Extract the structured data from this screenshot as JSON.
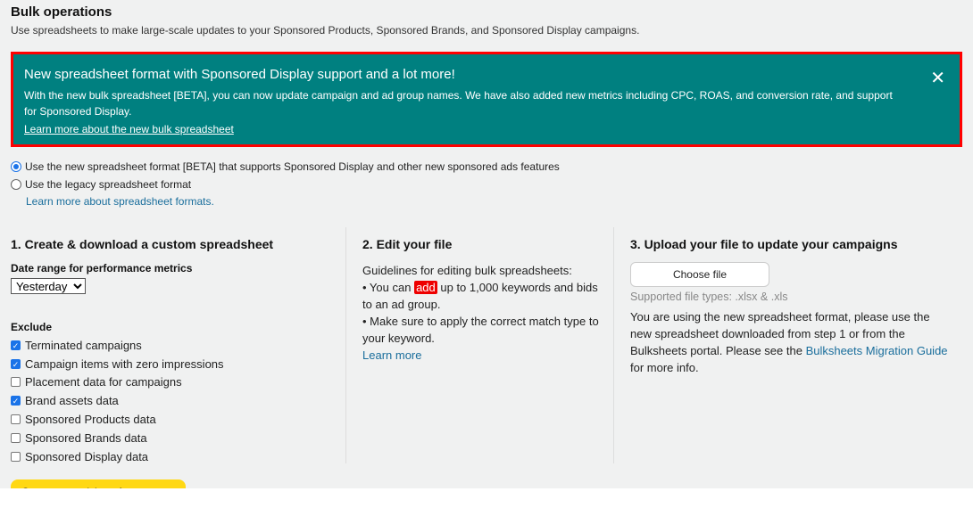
{
  "header": {
    "title": "Bulk operations",
    "subtitle": "Use spreadsheets to make large-scale updates to your Sponsored Products, Sponsored Brands, and Sponsored Display campaigns."
  },
  "banner": {
    "title": "New spreadsheet format with Sponsored Display support and a lot more!",
    "body": "With the new bulk spreadsheet [BETA], you can now update campaign and ad group names. We have also added new metrics including CPC, ROAS, and conversion rate, and support for Sponsored Display.",
    "link": "Learn more about the new bulk spreadsheet",
    "close": "✕",
    "bg": "#008080",
    "border": "#ff0000"
  },
  "format": {
    "options": [
      {
        "label": "Use the new spreadsheet format [BETA] that supports Sponsored Display and other new sponsored ads features",
        "selected": true
      },
      {
        "label": "Use the legacy spreadsheet format",
        "selected": false
      }
    ],
    "link": "Learn more about spreadsheet formats."
  },
  "step1": {
    "title": "1. Create & download a custom spreadsheet",
    "date_label": "Date range for performance metrics",
    "date_value": "Yesterday",
    "exclude_label": "Exclude",
    "excludes": [
      {
        "label": "Terminated campaigns",
        "checked": true
      },
      {
        "label": "Campaign items with zero impressions",
        "checked": true
      },
      {
        "label": "Placement data for campaigns",
        "checked": false
      },
      {
        "label": "Brand assets data",
        "checked": true
      },
      {
        "label": "Sponsored Products data",
        "checked": false
      },
      {
        "label": "Sponsored Brands data",
        "checked": false
      },
      {
        "label": "Sponsored Display data",
        "checked": false
      }
    ],
    "button": "Create spreadsheet for download"
  },
  "step2": {
    "title": "2. Edit your file",
    "intro": "Guidelines for editing bulk spreadsheets:",
    "b1_pre": "• You can ",
    "b1_hl": "add",
    "b1_post": " up to 1,000 keywords and bids to an ad group.",
    "b2": "• Make sure to apply the correct match type to your keyword.",
    "link": "Learn more"
  },
  "step3": {
    "title": "3. Upload your file to update your campaigns",
    "button": "Choose file",
    "types": "Supported file types: .xlsx & .xls",
    "body": "You are using the new spreadsheet format, please use the new spreadsheet downloaded from step 1 or from the Bulksheets portal. Please see the ",
    "link": "Bulksheets Migration Guide",
    "body_end": " for more info."
  }
}
